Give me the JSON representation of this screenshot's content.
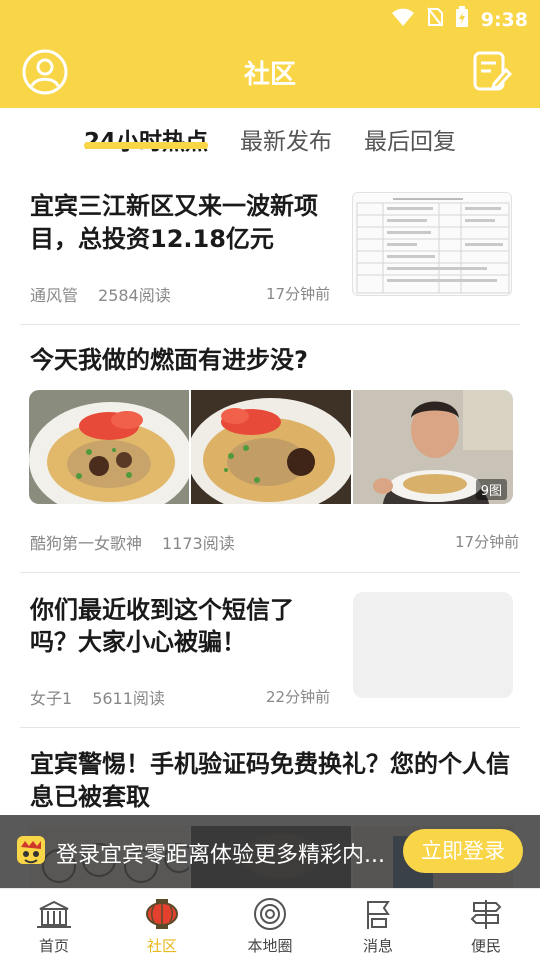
{
  "status_bar": {
    "time": "9:38"
  },
  "header": {
    "title": "社区"
  },
  "tabs": [
    {
      "label": "24小时热点",
      "active": true
    },
    {
      "label": "最新发布",
      "active": false
    },
    {
      "label": "最后回复",
      "active": false
    }
  ],
  "posts": [
    {
      "title_line1": "宜宾三江新区又来一波新项",
      "title_line2": "目，总投资12.18亿元",
      "author": "通风管",
      "reads": "2584阅读",
      "time": "17分钟前"
    },
    {
      "title": "今天我做的燃面有进步没?",
      "image_count": "9图",
      "author": "酷狗第一女歌神",
      "reads": "1173阅读",
      "time": "17分钟前"
    },
    {
      "title_line1": "你们最近收到这个短信了",
      "title_line2": "吗？大家小心被骗！",
      "author": "女子1",
      "reads": "5611阅读",
      "time": "22分钟前"
    },
    {
      "title_line1": "宜宾警惕！手机验证码免费换礼？您的个人信",
      "title_line2": "息已被套取"
    }
  ],
  "login_banner": {
    "text": "登录宜宾零距离体验更多精彩内...",
    "button": "立即登录"
  },
  "bottom_nav": [
    {
      "label": "首页",
      "icon": "home-building-icon",
      "active": false
    },
    {
      "label": "社区",
      "icon": "community-lantern-icon",
      "active": true
    },
    {
      "label": "本地圈",
      "icon": "local-circle-icon",
      "active": false
    },
    {
      "label": "消息",
      "icon": "message-flag-icon",
      "active": false
    },
    {
      "label": "便民",
      "icon": "service-sign-icon",
      "active": false
    }
  ],
  "colors": {
    "brand_yellow": "#f9d548",
    "active_nav": "#e8b820",
    "text_dark": "#1a1a1a",
    "text_meta": "#888888"
  }
}
